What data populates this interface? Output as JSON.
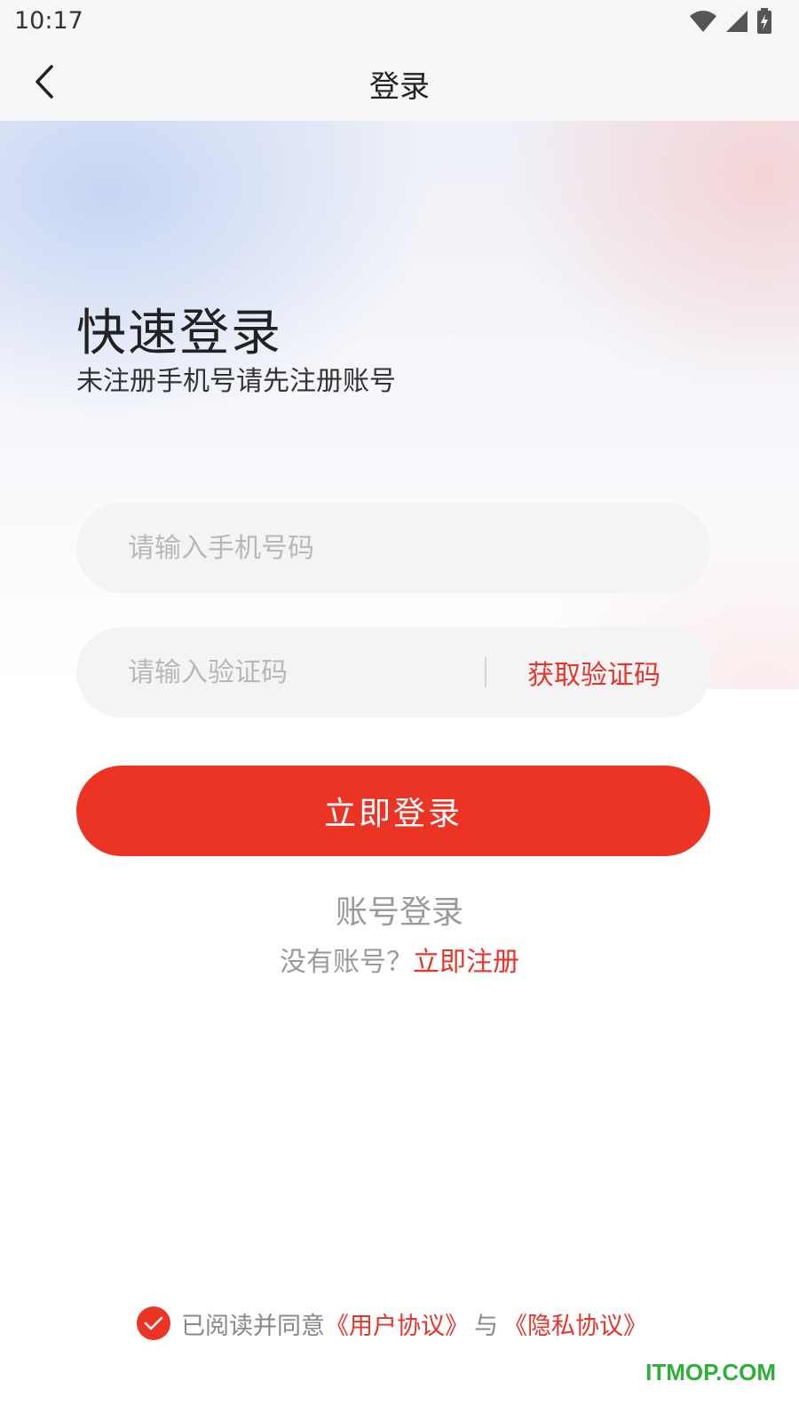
{
  "status_bar": {
    "time": "10:17",
    "icons": [
      "wifi-icon",
      "signal-icon",
      "battery-charging-icon"
    ]
  },
  "nav": {
    "title": "登录",
    "back_icon": "chevron-left-icon"
  },
  "hero": {
    "headline": "快速登录",
    "subline": "未注册手机号请先注册账号"
  },
  "form": {
    "phone_placeholder": "请输入手机号码",
    "code_placeholder": "请输入验证码",
    "get_code_label": "获取验证码",
    "login_button": "立即登录"
  },
  "links": {
    "account_login": "账号登录",
    "no_account_prefix": "没有账号？",
    "register": "立即注册"
  },
  "agreement": {
    "checked": true,
    "prefix": "已阅读并同意",
    "user_agreement": "《用户协议》",
    "and": "与",
    "privacy_policy": "《隐私协议》"
  },
  "watermark": "ITMOP.COM",
  "colors": {
    "accent": "#eb3424",
    "link": "#e8342a",
    "bar_bg": "#f6f6f6",
    "field_bg": "#f4f4f4",
    "watermark": "#2fae3a"
  }
}
